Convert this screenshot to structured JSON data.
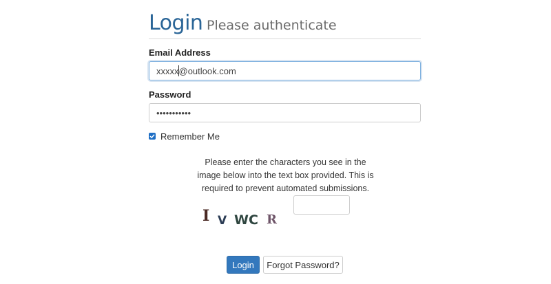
{
  "header": {
    "title": "Login",
    "subtitle": "Please authenticate"
  },
  "email": {
    "label": "Email Address",
    "value": "xxxxx@outlook.com"
  },
  "password": {
    "label": "Password",
    "masked_value": "•••••••••••"
  },
  "remember": {
    "label": "Remember Me",
    "checked": true
  },
  "captcha": {
    "instructions": "Please enter the characters you see in the image below into the text box provided. This is required to prevent automated submissions.",
    "image_chars": [
      "I",
      "V",
      "WC",
      "R"
    ],
    "input_value": ""
  },
  "buttons": {
    "login": "Login",
    "forgot": "Forgot Password?"
  },
  "colors": {
    "title": "#2a6597",
    "primary": "#3378bd",
    "checkbox": "#1f6fc5"
  }
}
